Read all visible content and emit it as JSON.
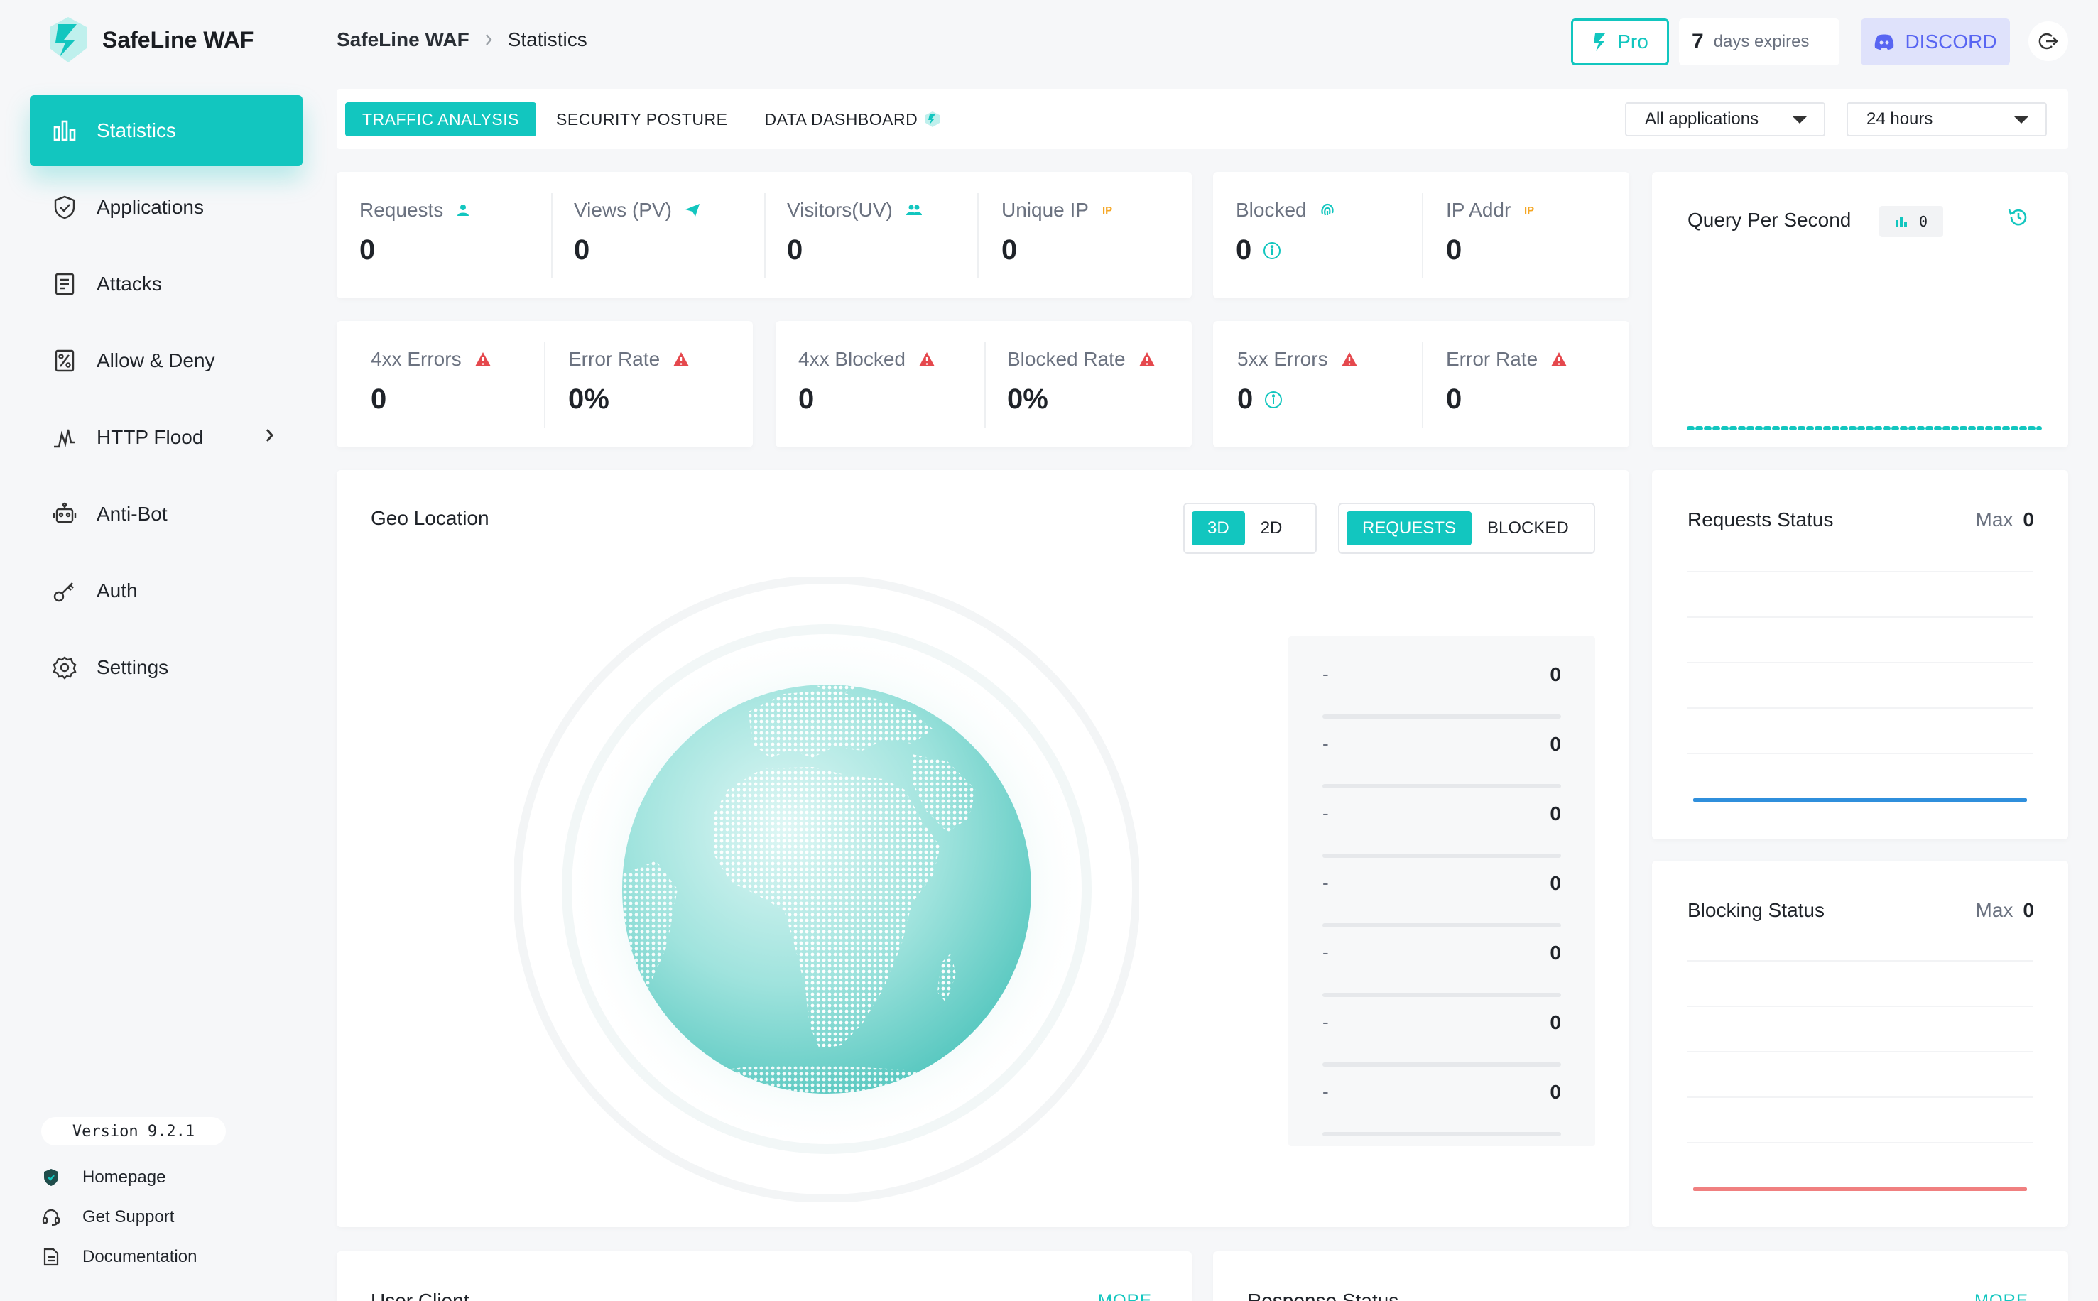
{
  "brand": {
    "name": "SafeLine WAF"
  },
  "colors": {
    "accent": "#12c6bf",
    "discord": "#5865f2",
    "warning": "#e5484d",
    "ip_badge": "#f5a623",
    "requests_line": "#2f8fdc",
    "blocking_line": "#f08080"
  },
  "sidebar": {
    "items": [
      {
        "label": "Statistics",
        "icon": "bar-chart-icon",
        "active": true
      },
      {
        "label": "Applications",
        "icon": "shield-icon"
      },
      {
        "label": "Attacks",
        "icon": "report-icon"
      },
      {
        "label": "Allow & Deny",
        "icon": "percent-list-icon"
      },
      {
        "label": "HTTP Flood",
        "icon": "pulse-icon",
        "has_submenu": true
      },
      {
        "label": "Anti-Bot",
        "icon": "robot-icon"
      },
      {
        "label": "Auth",
        "icon": "key-icon"
      },
      {
        "label": "Settings",
        "icon": "gear-icon"
      }
    ],
    "version": "Version 9.2.1",
    "footer_links": [
      {
        "label": "Homepage",
        "icon": "homepage-shield-icon"
      },
      {
        "label": "Get Support",
        "icon": "headset-icon"
      },
      {
        "label": "Documentation",
        "icon": "document-icon"
      }
    ]
  },
  "header": {
    "breadcrumb": {
      "root": "SafeLine WAF",
      "current": "Statistics"
    },
    "pro_label": "Pro",
    "expires_days": "7",
    "expires_text": "days expires",
    "discord_label": "DISCORD"
  },
  "toolbar": {
    "tabs": [
      {
        "label": "TRAFFIC ANALYSIS",
        "active": true
      },
      {
        "label": "SECURITY POSTURE"
      },
      {
        "label": "DATA DASHBOARD"
      }
    ],
    "app_filter": "All applications",
    "time_filter": "24 hours"
  },
  "stats_top": [
    {
      "label": "Requests",
      "value": "0",
      "icon": "user-icon"
    },
    {
      "label": "Views (PV)",
      "value": "0",
      "icon": "send-icon"
    },
    {
      "label": "Visitors(UV)",
      "value": "0",
      "icon": "users-icon"
    },
    {
      "label": "Unique IP",
      "value": "0",
      "icon": "ip-badge-icon"
    }
  ],
  "stats_blocked": [
    {
      "label": "Blocked",
      "value": "0",
      "icon": "fingerprint-icon"
    },
    {
      "label": "IP Addr",
      "value": "0",
      "icon": "ip-badge-icon"
    }
  ],
  "stats_errors_4xx": [
    {
      "label": "4xx Errors",
      "value": "0"
    },
    {
      "label": "Error Rate",
      "value": "0%"
    }
  ],
  "stats_blocked_4xx": [
    {
      "label": "4xx Blocked",
      "value": "0"
    },
    {
      "label": "Blocked Rate",
      "value": "0%"
    }
  ],
  "stats_errors_5xx": [
    {
      "label": "5xx Errors",
      "value": "0"
    },
    {
      "label": "Error Rate",
      "value": "0"
    }
  ],
  "qps": {
    "title": "Query Per Second",
    "badge_value": "0"
  },
  "geo": {
    "title": "Geo Location",
    "view_modes": [
      "3D",
      "2D"
    ],
    "metrics": [
      "REQUESTS",
      "BLOCKED"
    ],
    "rows": [
      {
        "name": "-",
        "value": "0"
      },
      {
        "name": "-",
        "value": "0"
      },
      {
        "name": "-",
        "value": "0"
      },
      {
        "name": "-",
        "value": "0"
      },
      {
        "name": "-",
        "value": "0"
      },
      {
        "name": "-",
        "value": "0"
      },
      {
        "name": "-",
        "value": "0"
      }
    ]
  },
  "requests_status": {
    "title": "Requests Status",
    "max_label": "Max",
    "max_value": "0"
  },
  "blocking_status": {
    "title": "Blocking Status",
    "max_label": "Max",
    "max_value": "0"
  },
  "bottom_cards": [
    {
      "title": "User Client",
      "more": "MORE"
    },
    {
      "title": "Response Status",
      "more": "MORE"
    }
  ]
}
